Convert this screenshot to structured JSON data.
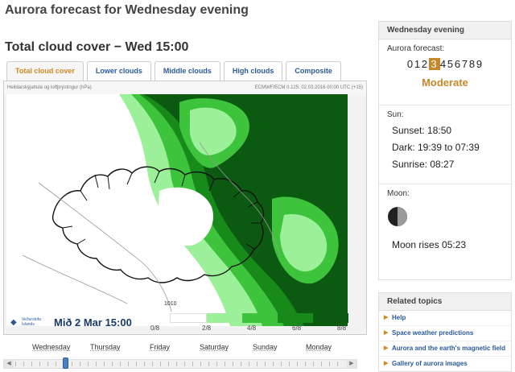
{
  "page": {
    "title": "Aurora forecast for Wednesday evening",
    "section_title": "Total cloud cover − Wed 15:00"
  },
  "tabs": [
    {
      "label": "Total cloud cover",
      "active": true
    },
    {
      "label": "Lower clouds",
      "active": false
    },
    {
      "label": "Middle clouds",
      "active": false
    },
    {
      "label": "High clouds",
      "active": false
    },
    {
      "label": "Composite",
      "active": false
    }
  ],
  "map": {
    "header_left": "Heildarskýjahula og loftþrýstingur (hPa)",
    "header_right": "ECMWF/ECM 0.125: 02.03.2016 00:00 UTC (+15)",
    "isobar_label": "1010",
    "logo_icon": "vedurstofa-logo-icon",
    "logo_text": "Veðurstofa Íslands",
    "timestamp": "Mið 2 Mar 15:00",
    "colors": {
      "clear": "#ffffff",
      "cloud_2_8": "#9cf09a",
      "cloud_4_8": "#3ec33c",
      "cloud_6_8": "#178a1a",
      "cloud_8_8": "#0c5a12",
      "coast": "#111111",
      "isobar": "#999999"
    },
    "legend": {
      "ticks": [
        "0/8",
        "2/8",
        "4/8",
        "6/8",
        "8/8"
      ],
      "swatches": [
        "#ffffff",
        "#9cf09a",
        "#3ec33c",
        "#178a1a",
        "#0c5a12"
      ]
    }
  },
  "slider": {
    "days": [
      "Wednesday",
      "Thursday",
      "Friday",
      "Saturday",
      "Sunday",
      "Monday"
    ],
    "left_arrow_icon": "chevron-left-icon",
    "right_arrow_icon": "chevron-right-icon",
    "position_fraction": 0.15
  },
  "sidebar": {
    "header": "Wednesday evening",
    "forecast_label": "Aurora forecast:",
    "kp_scale": [
      "0",
      "1",
      "2",
      "3",
      "4",
      "5",
      "6",
      "7",
      "8",
      "9"
    ],
    "kp_selected": "3",
    "kp_selected_color": "#c8882a",
    "activity": "Moderate",
    "sun": {
      "label": "Sun:",
      "sunset": "Sunset: 18:50",
      "dark": "Dark: 19:39 to 07:39",
      "sunrise": "Sunrise: 08:27"
    },
    "moon": {
      "label": "Moon:",
      "icon": "half-moon-icon",
      "rises": "Moon rises 05:23"
    }
  },
  "related": {
    "header": "Related topics",
    "items": [
      "Help",
      "Space weather predictions",
      "Aurora and the earth's magnetic field",
      "Gallery of aurora images"
    ]
  }
}
